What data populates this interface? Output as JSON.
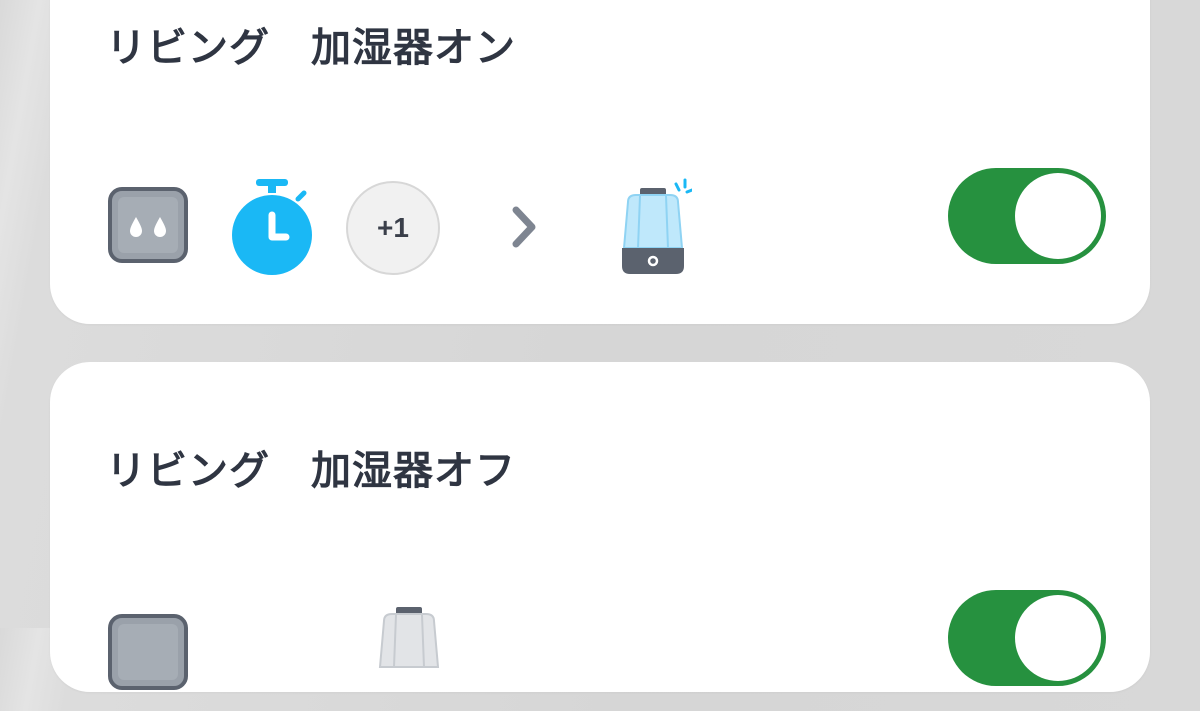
{
  "automations": [
    {
      "title": "リビング　加湿器オン",
      "condition_more_count": "+1",
      "enabled": true
    },
    {
      "title": "リビング　加湿器オフ",
      "enabled": true
    }
  ],
  "icons": {
    "condition_sensor": "humidity-sensor-icon",
    "condition_timer": "timer-icon",
    "arrow": "chevron-right-icon",
    "action_device": "humidifier-icon"
  },
  "colors": {
    "toggle_on": "#26913f",
    "timer_blue": "#1ab8f5",
    "title_text": "#2f3542"
  }
}
